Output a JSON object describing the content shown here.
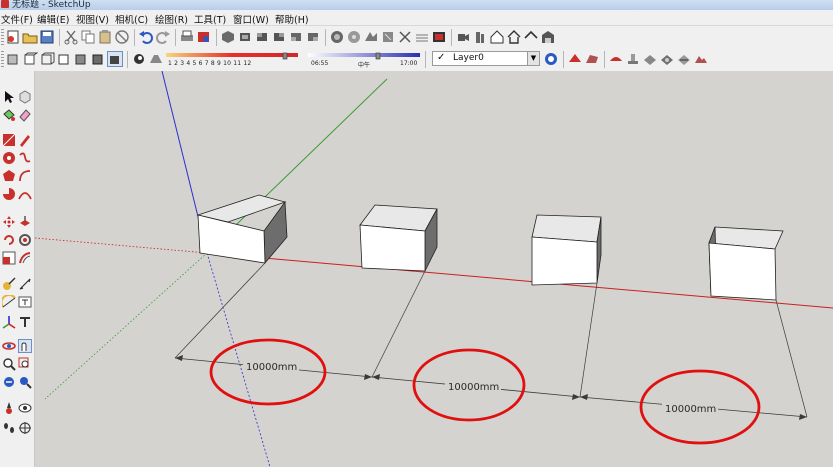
{
  "window": {
    "title": "无标题 - SketchUp"
  },
  "menu": [
    {
      "id": "file",
      "label": "文件(F)"
    },
    {
      "id": "edit",
      "label": "编辑(E)"
    },
    {
      "id": "view",
      "label": "视图(V)"
    },
    {
      "id": "camera",
      "label": "相机(C)"
    },
    {
      "id": "draw",
      "label": "绘图(R)"
    },
    {
      "id": "tools",
      "label": "工具(T)"
    },
    {
      "id": "window",
      "label": "窗口(W)"
    },
    {
      "id": "help",
      "label": "帮助(H)"
    }
  ],
  "shadow_scale": {
    "numbers": "1 2 3 4 5 6 7 8 9 10 11 12"
  },
  "time_slider": {
    "start": "06:55",
    "mid": "中午",
    "end": "17:00"
  },
  "layer": {
    "current": "Layer0",
    "check": "✓"
  },
  "dimensions": [
    "10000mm",
    "10000mm",
    "10000mm"
  ],
  "colors": {
    "axis_red": "#cc1f1f",
    "axis_green": "#3b9a32",
    "axis_blue": "#2b2fd0",
    "annotation": "#e01010",
    "viewport_bg": "#d4d3cf"
  }
}
